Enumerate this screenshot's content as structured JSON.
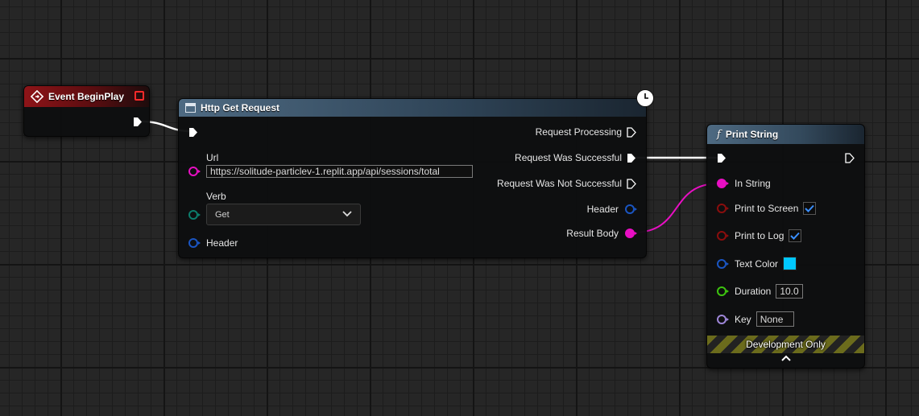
{
  "nodes": {
    "event_begin_play": {
      "title": "Event BeginPlay"
    },
    "http_get_request": {
      "title": "Http Get Request",
      "inputs": {
        "url_label": "Url",
        "url_value": "https://solitude-particlev-1.replit.app/api/sessions/total",
        "verb_label": "Verb",
        "verb_value": "Get",
        "header_label": "Header"
      },
      "outputs": {
        "request_processing": "Request Processing",
        "request_successful": "Request Was Successful",
        "request_not_successful": "Request Was Not Successful",
        "header": "Header",
        "result_body": "Result Body"
      }
    },
    "print_string": {
      "title": "Print String",
      "function_glyph": "f",
      "inputs": {
        "in_string": "In String",
        "print_to_screen": "Print to Screen",
        "print_to_screen_checked": true,
        "print_to_log": "Print to Log",
        "print_to_log_checked": true,
        "text_color_label": "Text Color",
        "text_color_value": "#00c8ff",
        "duration_label": "Duration",
        "duration_value": "10.0",
        "key_label": "Key",
        "key_value": "None"
      },
      "footer": "Development Only"
    }
  },
  "colors": {
    "event_header": "#7a0f12",
    "function_header": "#4e6a82",
    "exec_pin": "#ffffff",
    "string_pin": "#e80fc3",
    "struct_pin": "#1a55c2",
    "byte_pin": "#0c7d6c",
    "bool_pin": "#8a0d0d",
    "float_pin": "#3dc40f",
    "name_pin": "#9e86d8"
  },
  "icons": {
    "event": "event-diamond-icon",
    "latent": "clock-icon",
    "function": "function-icon",
    "expand": "chevron-up-icon"
  }
}
